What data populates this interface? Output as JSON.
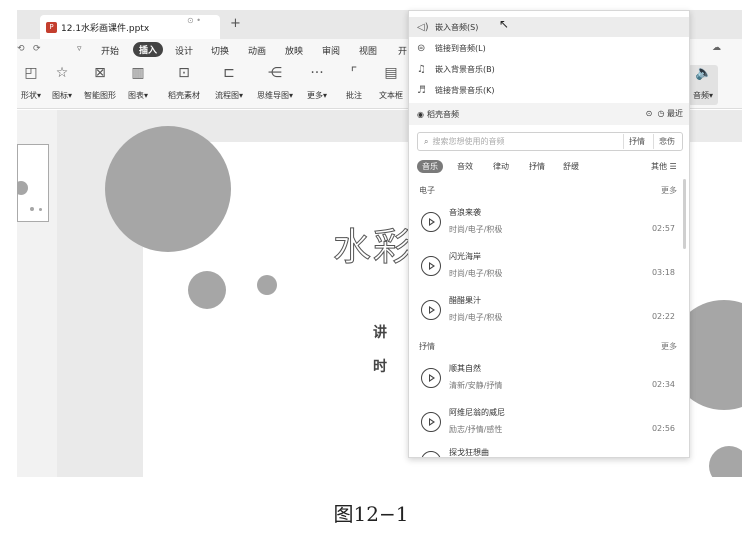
{
  "tab": {
    "title": "12.1水彩画课件.pptx",
    "add": "+"
  },
  "menubar": {
    "quick_access": [
      "⟲",
      "⟳",
      "▿"
    ],
    "items": [
      "开始",
      "插入",
      "设计",
      "切换",
      "动画",
      "放映",
      "审阅",
      "视图",
      "开"
    ],
    "active": "插入"
  },
  "ribbon": {
    "buttons": [
      {
        "label": "形状▾",
        "icon": "shape-icon"
      },
      {
        "label": "图标▾",
        "icon": "icons-icon"
      },
      {
        "label": "智能图形",
        "icon": "smartart-icon"
      },
      {
        "label": "图表▾",
        "icon": "chart-icon"
      },
      {
        "label": "稻壳素材",
        "icon": "material-icon"
      },
      {
        "label": "流程图▾",
        "icon": "flowchart-icon"
      },
      {
        "label": "思维导图▾",
        "icon": "mindmap-icon"
      },
      {
        "label": "更多▾",
        "icon": "more-icon"
      },
      {
        "label": "批注",
        "icon": "comment-icon"
      },
      {
        "label": "文本框",
        "icon": "textbox-icon"
      }
    ],
    "audio_label": "音频▾"
  },
  "slide": {
    "title": "水彩",
    "line1": "讲 师",
    "line2": "时 间"
  },
  "dropdown": {
    "items": [
      {
        "label": "嵌入音频(S)",
        "icon": "speaker-icon"
      },
      {
        "label": "链接到音频(L)",
        "icon": "link-audio-icon"
      },
      {
        "label": "嵌入背景音乐(B)",
        "icon": "music-note-icon"
      },
      {
        "label": "链接背景音乐(K)",
        "icon": "music-link-icon"
      }
    ],
    "section_title": "稻壳音频",
    "recent": "最近",
    "search_placeholder": "搜索您想使用的音频",
    "search_tags": [
      "抒情",
      "悲伤"
    ],
    "categories": [
      "音乐",
      "音效",
      "律动",
      "抒情",
      "舒缓"
    ],
    "other": "其他 ☰",
    "groups": [
      {
        "name": "电子",
        "more": "更多",
        "tracks": [
          {
            "name": "音浪来袭",
            "genre": "时尚/电子/积极",
            "duration": "02:57"
          },
          {
            "name": "闪光海岸",
            "genre": "时尚/电子/积极",
            "duration": "03:18"
          },
          {
            "name": "醋醋果汁",
            "genre": "时尚/电子/积极",
            "duration": "02:22"
          }
        ]
      },
      {
        "name": "抒情",
        "more": "更多",
        "tracks": [
          {
            "name": "顺其自然",
            "genre": "清新/安静/抒情",
            "duration": "02:34"
          },
          {
            "name": "阿维尼翁的威尼",
            "genre": "励志/抒情/感性",
            "duration": "02:56"
          }
        ]
      }
    ],
    "partial_track": "探戈狂想曲"
  },
  "caption": "图12−1"
}
